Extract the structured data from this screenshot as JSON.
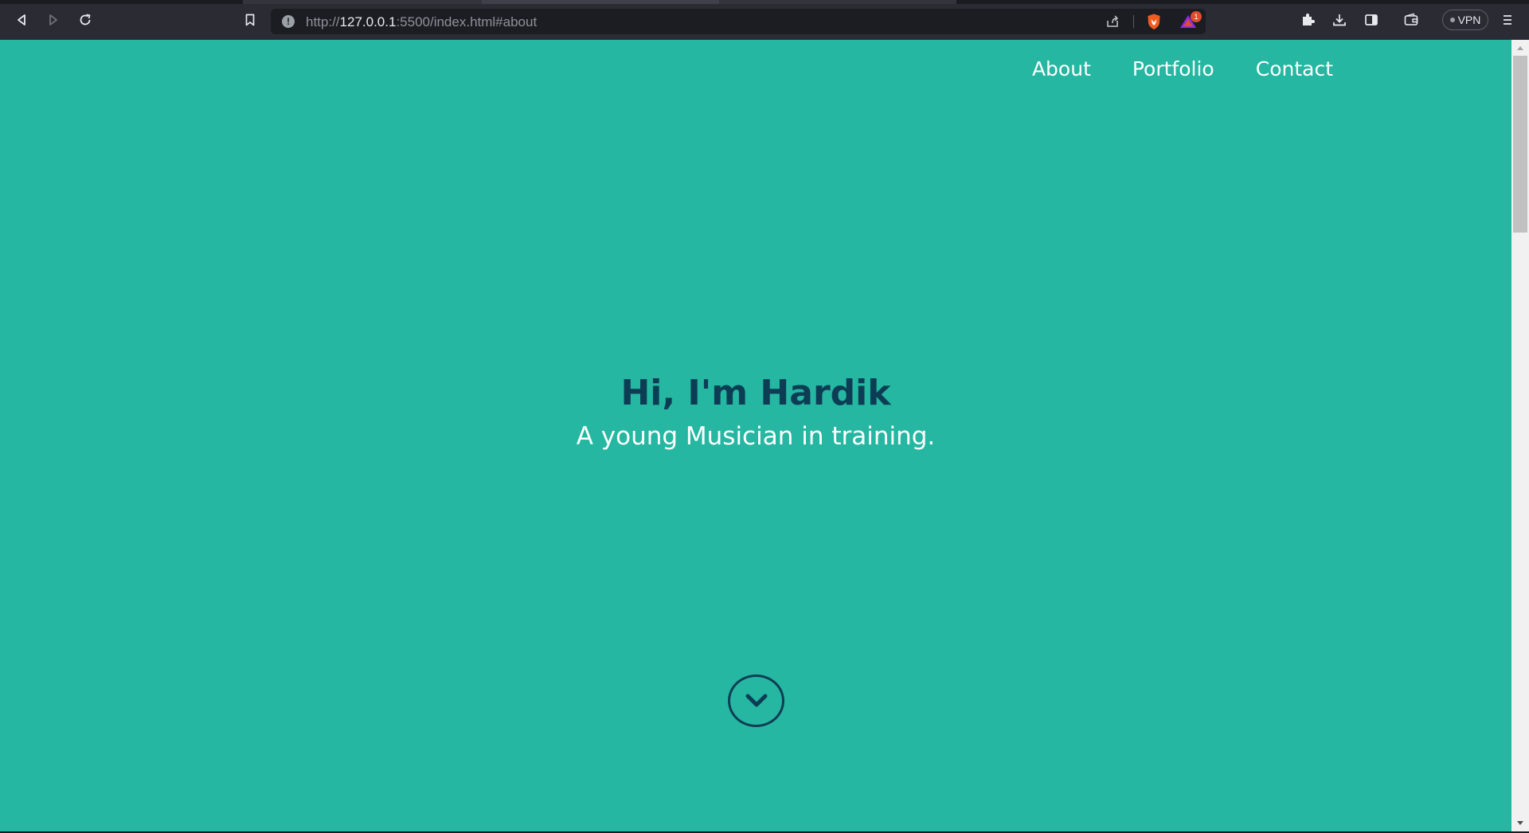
{
  "browser": {
    "url_scheme": "http://",
    "url_host": "127.0.0.1",
    "url_rest": ":5500/index.html#about",
    "rewards_badge": "1",
    "vpn_label": "VPN",
    "icons": [
      "back-icon",
      "forward-icon",
      "reload-icon",
      "bookmark-icon",
      "info-icon",
      "share-icon",
      "brave-shield-icon",
      "brave-rewards-icon",
      "extensions-icon",
      "downloads-icon",
      "sidebar-icon",
      "wallet-icon",
      "menu-icon"
    ]
  },
  "page": {
    "background_color": "#25b7a1",
    "accent_color": "#0d3d54",
    "nav": {
      "about": "About",
      "portfolio": "Portfolio",
      "contact": "Contact"
    },
    "hero": {
      "title": "Hi, I'm Hardik",
      "subtitle": "A young Musician in training."
    },
    "scroll_down_icon": "chevron-down-icon"
  }
}
